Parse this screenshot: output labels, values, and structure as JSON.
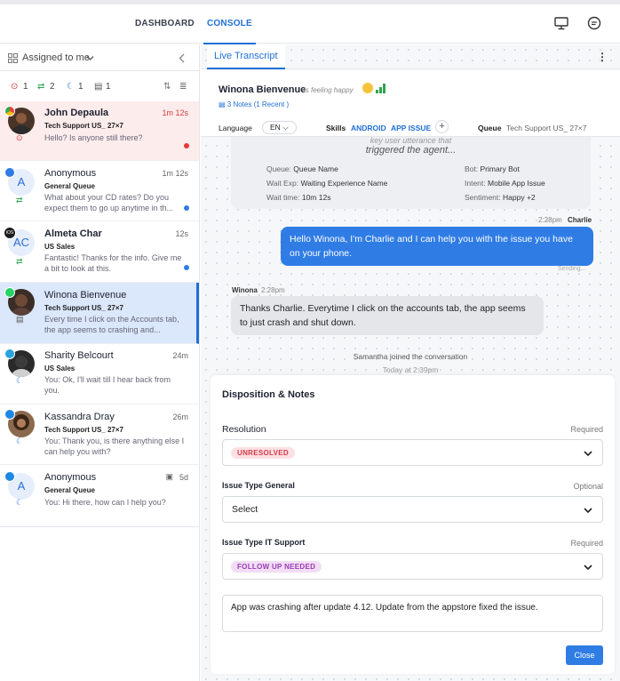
{
  "nav": {
    "tabs": [
      "DASHBOARD",
      "CONSOLE"
    ],
    "active_tab": "CONSOLE",
    "icons": [
      "monitor-icon",
      "chat-help-icon"
    ]
  },
  "sidebar": {
    "filter_label": "Assigned to me",
    "counts": [
      {
        "icon": "alert-icon",
        "value": "1",
        "color": "#d23b3b"
      },
      {
        "icon": "transfer-icon",
        "value": "2",
        "color": "#2ea44f"
      },
      {
        "icon": "moon-icon",
        "value": "1",
        "color": "#2f7ce5"
      },
      {
        "icon": "note-icon",
        "value": "1",
        "color": "#555555"
      }
    ],
    "conversations": [
      {
        "name": "John Depaula",
        "time": "1m 12s",
        "queue": "Tech Support US_ 27×7",
        "message": "Hello? Is anyone still there?",
        "channel": "chrome",
        "unread_dot": "#e53935"
      },
      {
        "name": "Anonymous",
        "time": "1m 12s",
        "queue": "General Queue",
        "message": "What about your CD rates? Do you expect them to go up anytime in th...",
        "channel": "web",
        "unread_dot": "#2f7ce5",
        "initial": "A"
      },
      {
        "name": "Almeta Char",
        "time": "12s",
        "queue": "US Sales",
        "message": "Fantastic! Thanks for the info. Give me a bit to look at this.",
        "channel": "ios",
        "unread_dot": "#2f7ce5",
        "initial": "AC",
        "channel_label": "iOS"
      },
      {
        "name": "Winona Bienvenue",
        "time": "",
        "queue": "Tech Support US_ 27×7",
        "message": "Every time I click on the Accounts tab, the app seems to crashing and...",
        "channel": "whatsapp"
      },
      {
        "name": "Sharity Belcourt",
        "time": "24m",
        "queue": "US Sales",
        "message": "You: Ok, I'll wait till I hear back from you.",
        "channel": "telegram"
      },
      {
        "name": "Kassandra Dray",
        "time": "26m",
        "queue": "Tech Support US_ 27×7",
        "message": "You: Thank you, is there anything else I can help you with?",
        "channel": "messenger"
      },
      {
        "name": "Anonymous",
        "time": "5d",
        "queue": "General Queue",
        "message": "You: Hi there, how can I help you?",
        "channel": "messenger",
        "initial": "A"
      }
    ]
  },
  "panel": {
    "tab_label": "Live Transcript",
    "customer_name": "Winona Bienvenue",
    "mood_text": "is feeling happy",
    "notes_label": "3 Notes (1 Recent )",
    "language_label": "Language",
    "language_value": "EN",
    "skills_label": "Skills",
    "skills": [
      "ANDROID",
      "APP ISSUE"
    ],
    "add_skill": "+",
    "queue_label": "Queue",
    "queue_value": "Tech Support US_ 27×7"
  },
  "transcript": {
    "system_partial": "key user utterance that",
    "system_triggered": "triggered the agent...",
    "details": {
      "queue_label": "Queue:",
      "queue_value": "Queue Name",
      "wait_exp_label": "Wait Exp:",
      "wait_exp_value": "Waiting Experience Name",
      "wait_time_label": "Wait time:",
      "wait_time_value": "10m 12s",
      "bot_label": "Bot:",
      "bot_value": "Primary Bot",
      "intent_label": "Intent:",
      "intent_value": "Mobile App Issue",
      "sentiment_label": "Sentiment:",
      "sentiment_value": "Happy +2"
    },
    "agent_time": "2:28pm",
    "agent_name": "Charlie",
    "agent_message": "Hello Winona, I'm Charlie and I can help you with the issue you have on your phone.",
    "agent_status": "Sending...",
    "customer_name": "Winona",
    "customer_time": "2:28pm",
    "customer_message": "Thanks Charlie. Everytime I click on the accounts tab, the app seems to just crash and shut down.",
    "event_text": "Samantha joined the conversation",
    "event_time": "Today at 2:39pm"
  },
  "disposition": {
    "title": "Disposition & Notes",
    "resolution_label": "Resolution",
    "resolution_req": "Required",
    "resolution_value": "UNRESOLVED",
    "general_label": "Issue Type General",
    "general_req": "Optional",
    "general_value": "Select",
    "it_label": "Issue Type IT Support",
    "it_req": "Required",
    "it_value": "FOLLOW UP NEEDED",
    "notes_text": "App was crashing after update 4.12. Update from the appstore fixed the  issue.",
    "close_label": "Close",
    "colors": {
      "unresolved_bg": "#fde0e3",
      "unresolved_fg": "#d23b4a",
      "followup_bg": "#f1def5",
      "followup_fg": "#9b3bb5"
    }
  }
}
